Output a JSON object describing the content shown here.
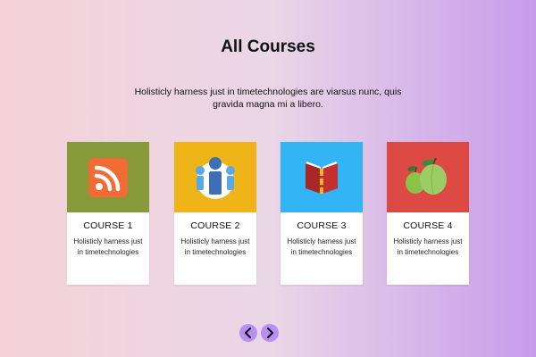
{
  "header": {
    "title": "All Courses",
    "subtitle": "Holisticly harness just in timetechnologies are viarsus nunc, quis gravida magna mi a libero."
  },
  "courses": [
    {
      "title": "COURSE 1",
      "description": "Holisticly harness just in timetechnologies",
      "icon": "rss-icon",
      "color": "#869a39"
    },
    {
      "title": "COURSE 2",
      "description": "Holisticly harness just in timetechnologies",
      "icon": "people-icon",
      "color": "#efb418"
    },
    {
      "title": "COURSE 3",
      "description": "Holisticly harness just in timetechnologies",
      "icon": "book-icon",
      "color": "#33b4f4"
    },
    {
      "title": "COURSE 4",
      "description": "Holisticly harness just in timetechnologies",
      "icon": "apples-icon",
      "color": "#dc4a43"
    }
  ],
  "navigation": {
    "prev_icon": "chevron-left-icon",
    "next_icon": "chevron-right-icon",
    "button_color": "#b88ff2"
  }
}
